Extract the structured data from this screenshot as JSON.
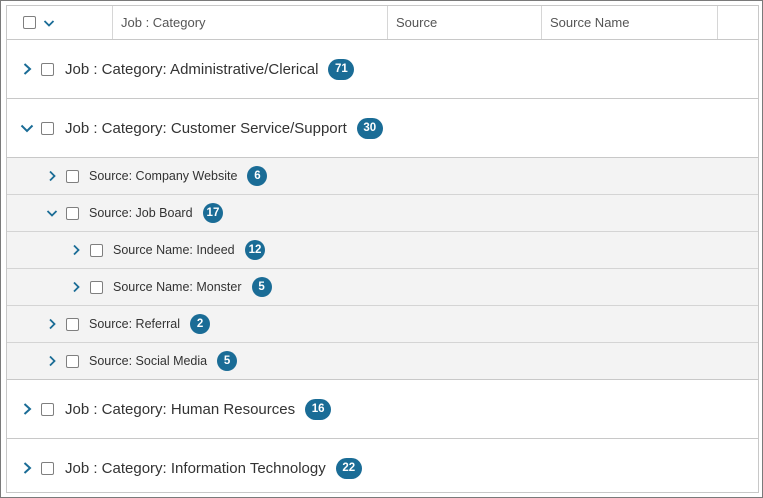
{
  "header": {
    "columns": [
      "Job : Category",
      "Source",
      "Source Name"
    ]
  },
  "rows": [
    {
      "label": "Job : Category: Administrative/Clerical",
      "count": "71",
      "expanded": false
    },
    {
      "label": "Job : Category: Customer Service/Support",
      "count": "30",
      "expanded": true
    },
    {
      "label": "Source: Company Website",
      "count": "6",
      "expanded": false
    },
    {
      "label": "Source: Job Board",
      "count": "17",
      "expanded": true
    },
    {
      "label": "Source Name: Indeed",
      "count": "12",
      "expanded": false
    },
    {
      "label": "Source Name: Monster",
      "count": "5",
      "expanded": false
    },
    {
      "label": "Source: Referral",
      "count": "2",
      "expanded": false
    },
    {
      "label": "Source: Social Media",
      "count": "5",
      "expanded": false
    },
    {
      "label": "Job : Category: Human Resources",
      "count": "16",
      "expanded": false
    },
    {
      "label": "Job : Category: Information Technology",
      "count": "22",
      "expanded": false
    }
  ],
  "colors": {
    "accent": "#1a6c96",
    "badge_text": "#ffffff",
    "subgroup_bg": "#f3f3f3"
  },
  "icons": {
    "collapsed": "chevron-right-icon",
    "expanded": "chevron-down-icon",
    "header_menu": "chevron-down-icon"
  }
}
